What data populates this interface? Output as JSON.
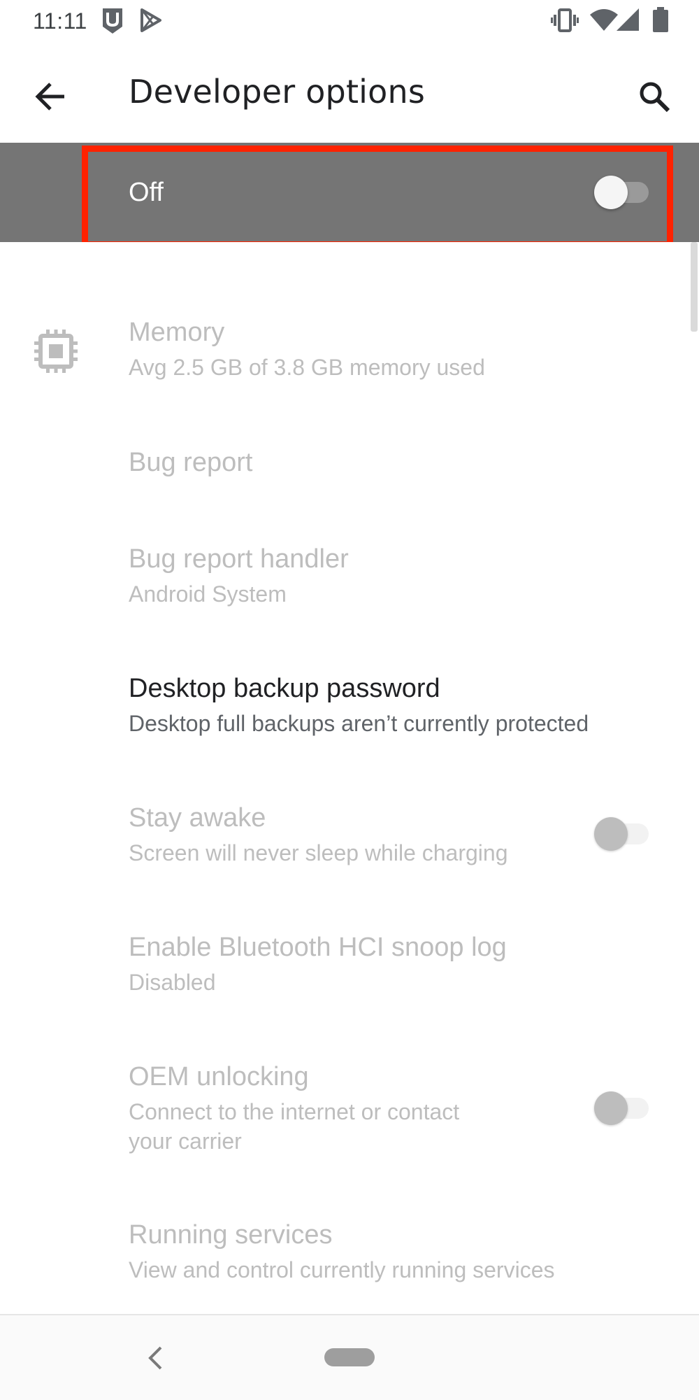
{
  "status_bar": {
    "time": "11:11",
    "left_icons": [
      "app-notification-icon",
      "play-store-icon"
    ],
    "right_icons": [
      "vibrate-icon",
      "wifi-icon",
      "signal-icon",
      "battery-icon"
    ]
  },
  "app_bar": {
    "title": "Developer options",
    "back_icon": "arrow-back-icon",
    "search_icon": "search-icon"
  },
  "master_switch": {
    "label": "Off",
    "checked": false,
    "highlight_color": "#ff2200"
  },
  "settings": {
    "memory": {
      "title": "Memory",
      "summary": "Avg 2.5 GB of 3.8 GB memory used",
      "icon": "memory-chip-icon",
      "enabled": false
    },
    "bug_report": {
      "title": "Bug report",
      "enabled": false
    },
    "bug_report_handler": {
      "title": "Bug report handler",
      "summary": "Android System",
      "enabled": false
    },
    "desktop_backup_password": {
      "title": "Desktop backup password",
      "summary": "Desktop full backups aren’t currently protected",
      "enabled": true
    },
    "stay_awake": {
      "title": "Stay awake",
      "summary": "Screen will never sleep while charging",
      "checked": false,
      "enabled": false
    },
    "bluetooth_hci": {
      "title": "Enable Bluetooth HCI snoop log",
      "summary": "Disabled",
      "enabled": false
    },
    "oem_unlocking": {
      "title": "OEM unlocking",
      "summary_line1": "Connect to the internet or contact",
      "summary_line2": "your carrier",
      "checked": false,
      "enabled": false
    },
    "running_services": {
      "title": "Running services",
      "summary": "View and control currently running services",
      "enabled": false
    }
  },
  "nav_bar": {
    "back_icon": "nav-back-icon",
    "home_pill": "home-pill"
  },
  "colors": {
    "master_bar": "#757575",
    "disabled_text": "#bdbdbd",
    "primary_text": "#202124",
    "secondary_text": "#5f6368"
  }
}
